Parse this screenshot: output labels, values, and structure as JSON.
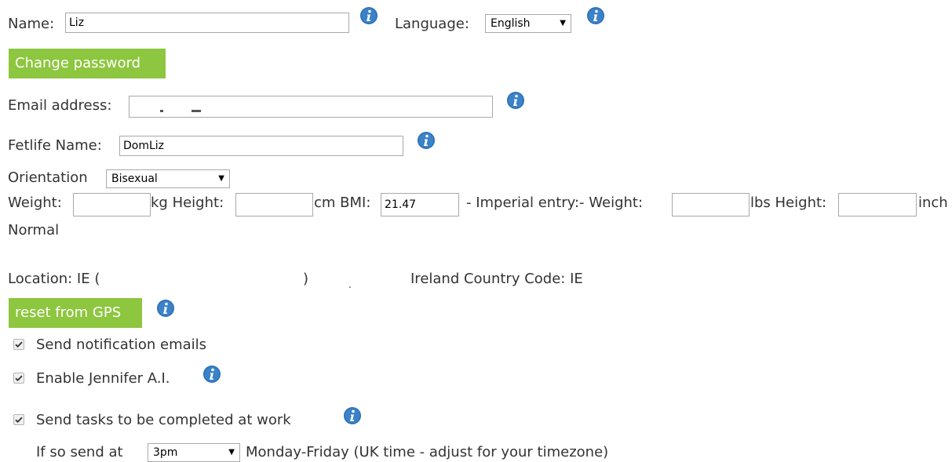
{
  "profile": {
    "name_label": "Name:",
    "name_value": "Liz",
    "language_label": "Language:",
    "language_value": "English",
    "change_password": "Change password",
    "email_label": "Email address:",
    "email_value": "",
    "fetlife_label": "Fetlife Name:",
    "fetlife_value": "DomLiz",
    "orientation_label": "Orientation",
    "orientation_value": "Bisexual"
  },
  "body_metrics": {
    "weight_label": "Weight:",
    "weight_kg": "",
    "kg_label": "kg Height:",
    "height_cm": "",
    "cm_bmi_label": "cm BMI:",
    "bmi_value": "21.47",
    "imperial_label": "- Imperial entry:- Weight:",
    "weight_lbs": "",
    "lbs_label": "lbs Height:",
    "height_inch": "",
    "inch_label": "inch",
    "bmi_category": "Normal"
  },
  "location": {
    "prefix": "Location: IE (",
    "paren_close": ")",
    "dot": ".",
    "country": "Ireland Country Code: IE",
    "reset_button": "reset from GPS"
  },
  "options": {
    "notify_label": "Send notification emails",
    "jennifer_label": "Enable Jennifer A.I.",
    "work_label": "Send tasks to be completed at work",
    "send_at_label": "If so send at",
    "send_at_value": "3pm",
    "send_at_suffix": "Monday-Friday (UK time - adjust for your timezone)"
  },
  "colors": {
    "button_green": "#8dc63f",
    "info_blue": "#2a6fb5"
  },
  "icons": [
    "info-icon",
    "checkmark-icon",
    "dropdown-arrow-icon"
  ]
}
